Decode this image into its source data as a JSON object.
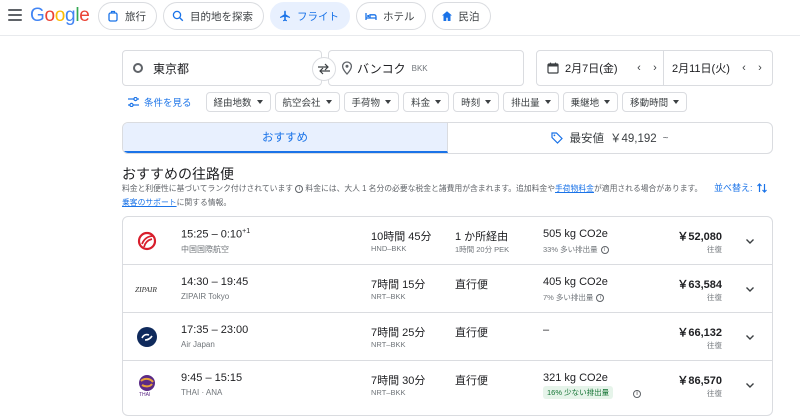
{
  "header": {
    "logo": "Google",
    "nav": [
      {
        "label": "旅行",
        "icon": "luggage-icon"
      },
      {
        "label": "目的地を探索",
        "icon": "explore-icon"
      },
      {
        "label": "フライト",
        "icon": "flight-icon",
        "active": true
      },
      {
        "label": "ホテル",
        "icon": "hotel-icon"
      },
      {
        "label": "民泊",
        "icon": "home-icon"
      }
    ]
  },
  "search": {
    "origin": "東京都",
    "destination": "バンコク",
    "destination_code": "BKK",
    "depart_date": "2月7日(金)",
    "return_date": "2月11日(火)"
  },
  "filters": {
    "more_label": "条件を見る",
    "chips": [
      "経由地数",
      "航空会社",
      "手荷物",
      "料金",
      "時刻",
      "排出量",
      "乗継地",
      "移動時間"
    ]
  },
  "tabs": {
    "best": "おすすめ",
    "cheapest": "最安値",
    "cheapest_price": "￥49,192"
  },
  "results": {
    "title": "おすすめの往路便",
    "note_1": "料金と利便性に基づいてランク付けされています",
    "note_2": "料金には、大人 1 名分の必要な税金と諸費用が含まれます。追加料金や",
    "note_link_1": "手荷物料金",
    "note_3": "が適用される場合があります。",
    "note_link_2": "乗客のサポート",
    "note_4": "に関する情報。",
    "sort_label": "並べ替え:",
    "colors": {
      "accent": "#1a73e8",
      "green_badge_bg": "#e6f4ea",
      "green_badge_text": "#137333"
    }
  },
  "flights": [
    {
      "times": "15:25 – 0:10",
      "plus": "+1",
      "airline": "中国国際航空",
      "duration": "10時間 45分",
      "route": "HND–BKK",
      "stops": "1 か所経由",
      "stop_info": "1時間 20分 PEK",
      "co2": "505 kg CO2e",
      "co2_note": "33% 多い排出量",
      "co2_green": false,
      "price": "￥52,080",
      "trip": "往復",
      "logo": "air-china-logo"
    },
    {
      "times": "14:30 – 19:45",
      "plus": "",
      "airline": "ZIPAIR Tokyo",
      "duration": "7時間 15分",
      "route": "NRT–BKK",
      "stops": "直行便",
      "stop_info": "",
      "co2": "405 kg CO2e",
      "co2_note": "7% 多い排出量",
      "co2_green": false,
      "price": "￥63,584",
      "trip": "往復",
      "logo": "zipair-logo"
    },
    {
      "times": "17:35 – 23:00",
      "plus": "",
      "airline": "Air Japan",
      "duration": "7時間 25分",
      "route": "NRT–BKK",
      "stops": "直行便",
      "stop_info": "",
      "co2": "–",
      "co2_note": "",
      "co2_green": false,
      "price": "￥66,132",
      "trip": "往復",
      "logo": "air-japan-logo"
    },
    {
      "times": "9:45 – 15:15",
      "plus": "",
      "airline": "THAI · ANA",
      "duration": "7時間 30分",
      "route": "NRT–BKK",
      "stops": "直行便",
      "stop_info": "",
      "co2": "321 kg CO2e",
      "co2_note": "16% 少ない排出量",
      "co2_green": true,
      "price": "￥86,570",
      "trip": "往復",
      "logo": "thai-airways-logo"
    }
  ]
}
